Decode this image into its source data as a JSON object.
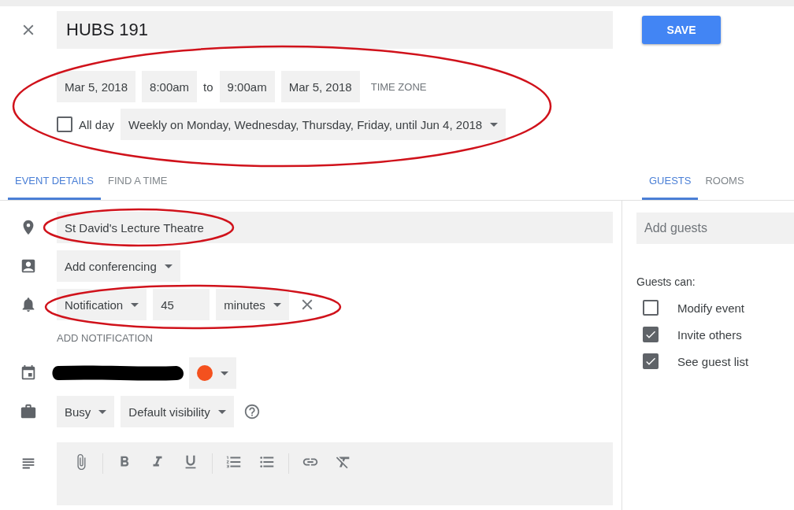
{
  "title": "HUBS 191",
  "save_button": "SAVE",
  "date_time": {
    "start_date": "Mar 5, 2018",
    "start_time": "8:00am",
    "separator": "to",
    "end_time": "9:00am",
    "end_date": "Mar 5, 2018",
    "time_zone": "TIME ZONE"
  },
  "all_day": {
    "label": "All day",
    "checked": false
  },
  "recurrence": "Weekly on Monday, Wednesday, Thursday, Friday, until Jun 4, 2018",
  "tabs": [
    {
      "label": "EVENT DETAILS",
      "selected": true
    },
    {
      "label": "FIND A TIME",
      "selected": false
    }
  ],
  "side_tabs": [
    {
      "label": "GUESTS",
      "selected": true
    },
    {
      "label": "ROOMS",
      "selected": false
    }
  ],
  "location": "St David's Lecture Theatre",
  "conferencing": "Add conferencing",
  "notification": {
    "type": "Notification",
    "amount": "45",
    "unit": "minutes"
  },
  "add_notification": "ADD NOTIFICATION",
  "availability": "Busy",
  "visibility": "Default visibility",
  "guests": {
    "placeholder": "Add guests",
    "permissions_label": "Guests can:",
    "permissions": [
      {
        "label": "Modify event",
        "checked": false
      },
      {
        "label": "Invite others",
        "checked": true
      },
      {
        "label": "See guest list",
        "checked": true
      }
    ]
  }
}
